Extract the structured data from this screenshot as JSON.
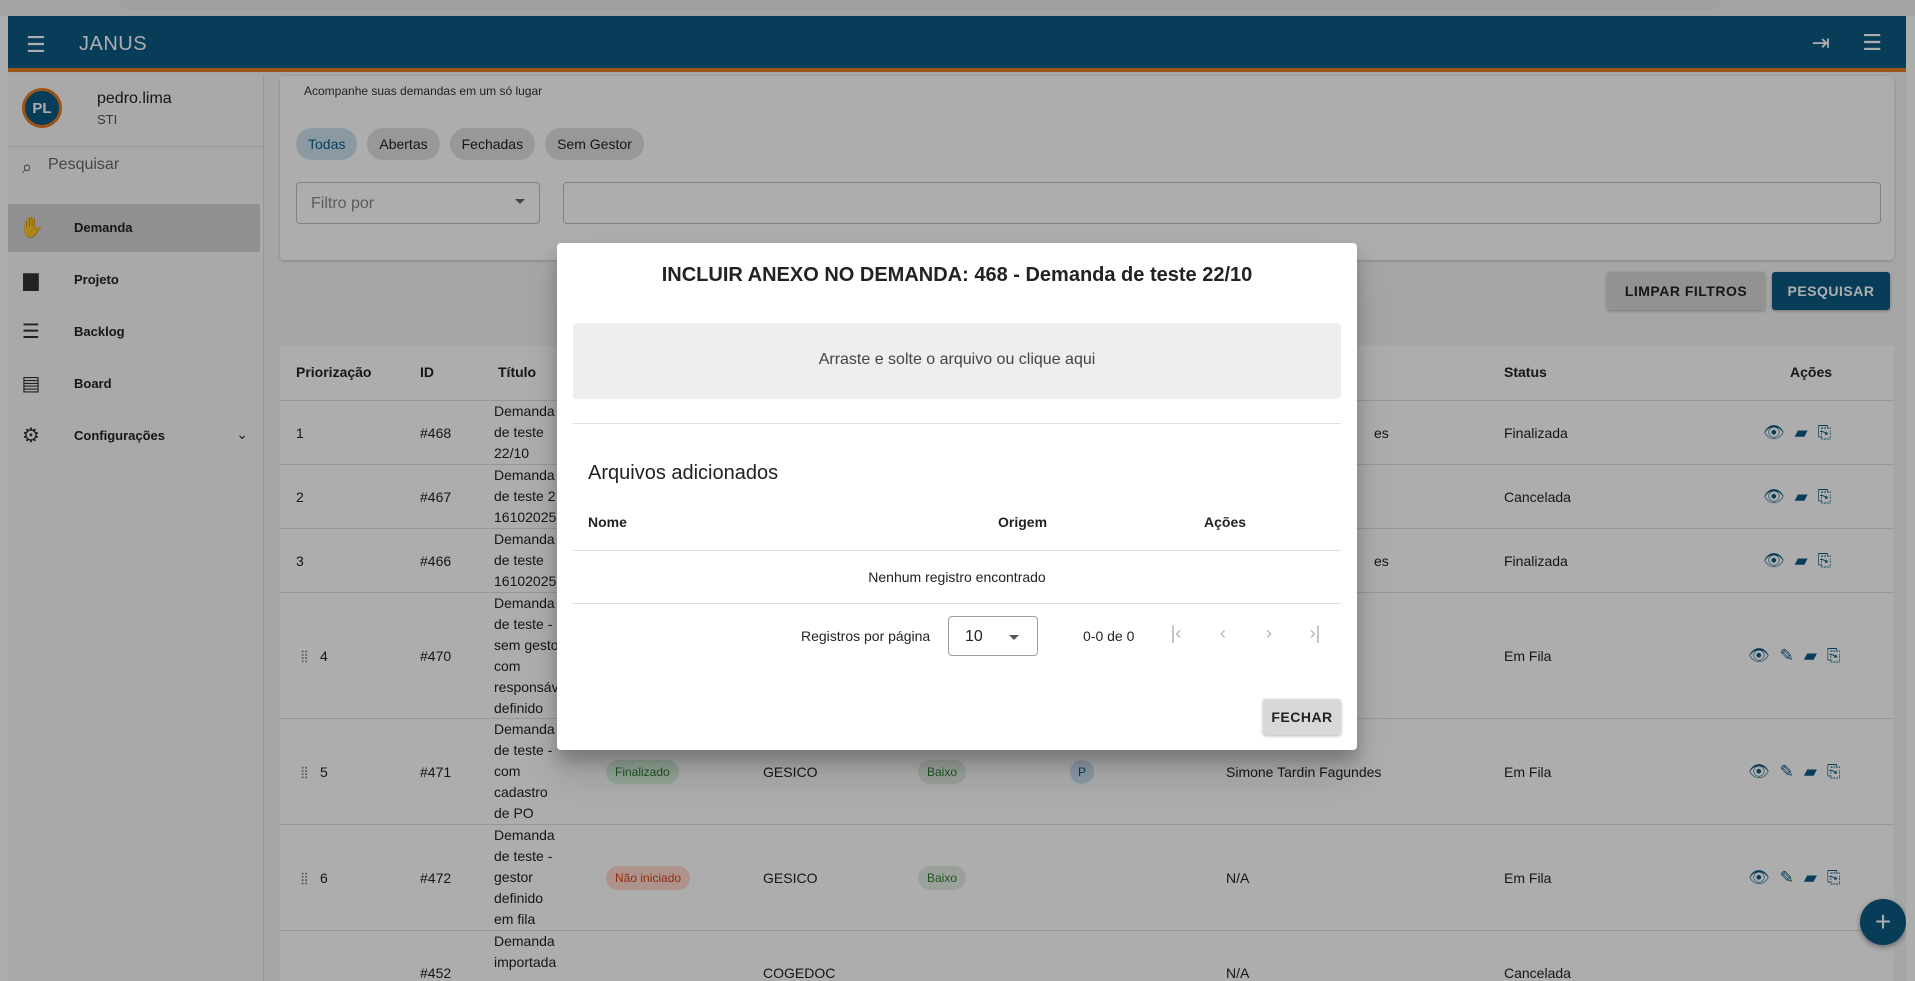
{
  "app": {
    "brand": "JANUS",
    "menu_icon": "menu-icon",
    "exit_icon": "logout-icon",
    "menu2_icon": "menu-icon"
  },
  "user": {
    "initials": "PL",
    "name": "pedro.lima",
    "dept": "STI"
  },
  "sidebar": {
    "search_placeholder": "Pesquisar",
    "items": [
      {
        "label": "Demanda",
        "icon": "hand-icon"
      },
      {
        "label": "Projeto",
        "icon": "folder-icon"
      },
      {
        "label": "Backlog",
        "icon": "list-icon"
      },
      {
        "label": "Board",
        "icon": "board-icon"
      },
      {
        "label": "Configurações",
        "icon": "gear-icon"
      }
    ]
  },
  "filters": {
    "subtitle": "Acompanhe suas demandas em um só lugar",
    "chips": [
      "Todas",
      "Abertas",
      "Fechadas",
      "Sem Gestor"
    ],
    "filter_placeholder": "Filtro por",
    "clear_label": "LIMPAR FILTROS",
    "search_label": "PESQUISAR"
  },
  "table": {
    "headers": [
      "Priorização",
      "ID",
      "Título",
      "Status",
      "Ações"
    ],
    "rows": [
      {
        "prio": "1",
        "id": "#468",
        "title": "Demanda de teste 22/10",
        "resp_tail": "es",
        "status": "Finalizada"
      },
      {
        "prio": "2",
        "id": "#467",
        "title": "Demanda de teste 2 16102025",
        "status": "Cancelada"
      },
      {
        "prio": "3",
        "id": "#466",
        "title": "Demanda de teste 16102025",
        "resp_tail": "es",
        "status": "Finalizada"
      },
      {
        "prio": "4",
        "id": "#470",
        "title": "Demanda de teste - sem gestor com responsável definido",
        "status": "Em Fila"
      },
      {
        "prio": "5",
        "id": "#471",
        "title": "Demanda de teste - com cadastro de PO",
        "situacao": "Finalizado",
        "sistema": "GESICO",
        "prioridade": "Baixo",
        "po": "P",
        "responsavel": "Simone Tardin Fagundes",
        "status": "Em Fila"
      },
      {
        "prio": "6",
        "id": "#472",
        "title": "Demanda de teste - gestor definido em fila",
        "situacao": "Não iniciado",
        "sistema": "GESICO",
        "prioridade": "Baixo",
        "responsavel": "N/A",
        "status": "Em Fila"
      },
      {
        "prio": "",
        "id": "#452",
        "title": "Demanda importada",
        "sistema": "COGEDOC",
        "responsavel": "N/A",
        "status": "Cancelada"
      }
    ]
  },
  "dialog": {
    "title": "INCLUIR ANEXO NO DEMANDA: 468 - Demanda de teste 22/10",
    "dropzone": "Arraste e solte o arquivo ou clique aqui",
    "subtitle": "Arquivos adicionados",
    "headers": [
      "Nome",
      "Origem",
      "Ações"
    ],
    "empty": "Nenhum registro encontrado",
    "per_page_label": "Registros por página",
    "per_page_value": "10",
    "range": "0-0 de 0",
    "close_label": "FECHAR"
  },
  "colors": {
    "primary": "#0d5b84",
    "accent": "#e57c23"
  }
}
